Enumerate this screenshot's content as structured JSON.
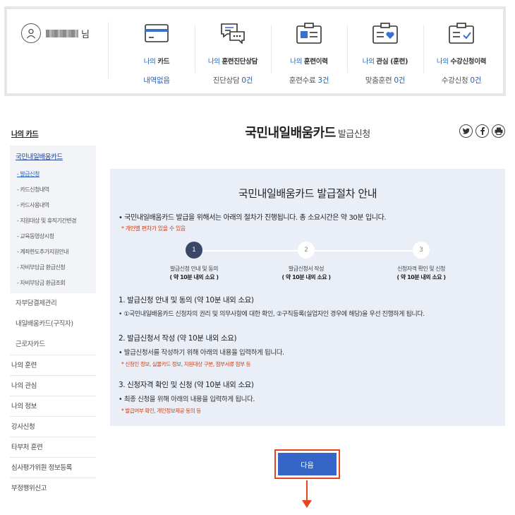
{
  "summary": {
    "user_suffix": "님",
    "columns": [
      {
        "icon": "card-icon",
        "pre": "나의",
        "main": "카드",
        "value_text": "내역없음",
        "value_num": ""
      },
      {
        "icon": "consult-icon",
        "pre": "나의",
        "main": "훈련진단상담",
        "value_text": "진단상담 ",
        "value_num": "0건"
      },
      {
        "icon": "history-icon",
        "pre": "나의",
        "main": "훈련이력",
        "value_text": "훈련수료 ",
        "value_num": "3건"
      },
      {
        "icon": "heart-box-icon",
        "pre": "나의",
        "main": "관심 (훈련)",
        "value_text": "맞춤훈련 ",
        "value_num": "0건"
      },
      {
        "icon": "check-box-icon",
        "pre": "나의",
        "main": "수강신청이력",
        "value_text": "수강신청 ",
        "value_num": "0건"
      }
    ]
  },
  "lnb": {
    "top": "나의 카드",
    "sub": "국민내일배움카드",
    "items": [
      "- 발급신청",
      "- 카드신청내역",
      "- 카드사용내역",
      "- 지원대상 및 휴직기간변경",
      "- 교육동영상시청",
      "- 계좌한도추가지원안내",
      "- 자비부담금 환급신청",
      "- 자비부담금 환급조회"
    ],
    "second": [
      "자부담결제관리",
      "내일배움카드(구직자)",
      "근로자카드"
    ],
    "first": [
      "나의 훈련",
      "나의 관심",
      "나의 정보",
      "강사신청",
      "타부처 훈련",
      "심사평가위원 정보등록",
      "부정행위신고"
    ]
  },
  "page": {
    "title": "국민내일배움카드",
    "subtitle": "발급신청"
  },
  "guide": {
    "title": "국민내일배움카드 발급절차 안내",
    "intro": "• 국민내일배움카드 발급을 위해서는 아래의 절차가 진행됩니다. 총 소요시간은 약 30분 입니다.",
    "note": "* 개인별 편차가 있을 수 있음",
    "steps": [
      {
        "num": "1",
        "label": "발급신청 안내 및 동의",
        "time": "( 약 10분 내외 소요 )"
      },
      {
        "num": "2",
        "label": "발급신청서 작성",
        "time": "( 약 10분 내외 소요 )"
      },
      {
        "num": "3",
        "label": "신청자격 확인 및 신청",
        "time": "( 약 10분 내외 소요 )"
      }
    ],
    "sections": [
      {
        "title": "1. 발급신청 안내 및 동의 (약 10분 내외 소요)",
        "desc": "• ①국민내일배움카드 신청자의 권리 및 의무사항에 대한 확인, ②구직등록(실업자인 경우에 해당)을 우선 진행하게 됩니다.",
        "note": ""
      },
      {
        "title": "2. 발급신청서 작성 (약 10분 내외 소요)",
        "desc": "• 발급신청서를 작성하기 위해 아래의 내용을 입력하게 됩니다.",
        "note": "* 신청인 정보, 실물카드 정보, 지원대상 구분, 첨부서류 첨부 등"
      },
      {
        "title": "3. 신청자격 확인 및 신청 (약 10분 내외 소요)",
        "desc": "• 최종 신청을 위해 아래의 내용을 입력하게 됩니다.",
        "note": "* 발급여부 확인, 개인정보제공 동의 등"
      }
    ]
  },
  "next_label": "다음",
  "colors": {
    "accent": "#1f5fbf",
    "button": "#3465c7",
    "highlight": "#e8451e",
    "panel": "#e9eef7"
  }
}
